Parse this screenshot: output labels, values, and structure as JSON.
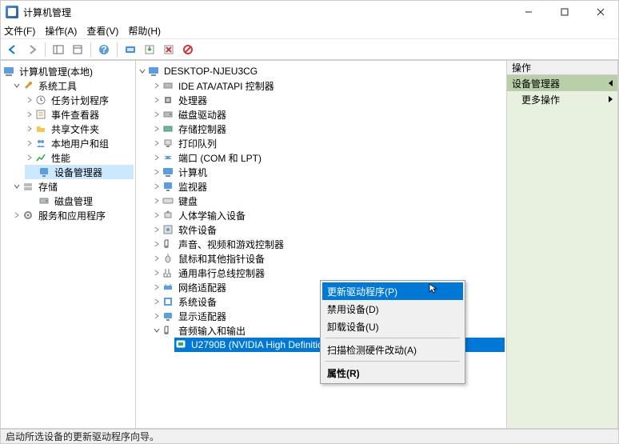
{
  "window": {
    "title": "计算机管理"
  },
  "menu": {
    "file": "文件(F)",
    "action": "操作(A)",
    "view": "查看(V)",
    "help": "帮助(H)"
  },
  "left_tree": {
    "root": "计算机管理(本地)",
    "system_tools": "系统工具",
    "task_scheduler": "任务计划程序",
    "event_viewer": "事件查看器",
    "shared_folders": "共享文件夹",
    "local_users": "本地用户和组",
    "performance": "性能",
    "device_manager": "设备管理器",
    "storage": "存储",
    "disk_mgmt": "磁盘管理",
    "services_apps": "服务和应用程序"
  },
  "mid_tree": {
    "root": "DESKTOP-NJEU3CG",
    "items": [
      "IDE ATA/ATAPI 控制器",
      "处理器",
      "磁盘驱动器",
      "存储控制器",
      "打印队列",
      "端口 (COM 和 LPT)",
      "计算机",
      "监视器",
      "键盘",
      "人体学输入设备",
      "软件设备",
      "声音、视频和游戏控制器",
      "鼠标和其他指针设备",
      "通用串行总线控制器",
      "网络适配器",
      "系统设备",
      "显示适配器",
      "音频输入和输出"
    ],
    "selected_item": "U2790B (NVIDIA High Definition Audio)"
  },
  "context_menu": {
    "update_driver": "更新驱动程序(P)",
    "disable": "禁用设备(D)",
    "uninstall": "卸载设备(U)",
    "scan": "扫描检测硬件改动(A)",
    "properties": "属性(R)"
  },
  "right_pane": {
    "header": "操作",
    "band1": "设备管理器",
    "band2": "更多操作"
  },
  "statusbar": "启动所选设备的更新驱动程序向导。",
  "icon_colors": {
    "arrow_back": "#0078d7",
    "arrow_fwd": "#7a7a7a",
    "green": "#2aa33a",
    "red": "#d13438",
    "amber": "#d79a2a",
    "purple": "#6b4aa0"
  }
}
